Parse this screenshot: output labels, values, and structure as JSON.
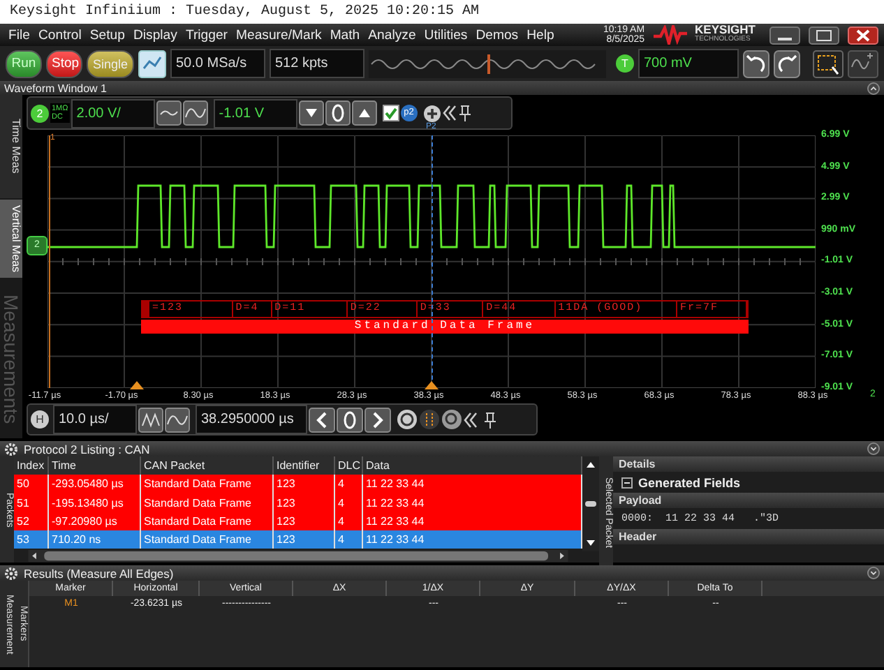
{
  "window": {
    "title": "Keysight Infiniium : Tuesday, August 5, 2025 10:20:15 AM"
  },
  "menu": [
    "File",
    "Control",
    "Setup",
    "Display",
    "Trigger",
    "Measure/Mark",
    "Math",
    "Analyze",
    "Utilities",
    "Demos",
    "Help"
  ],
  "clock": {
    "time": "10:19 AM",
    "date": "8/5/2025"
  },
  "logo": {
    "name": "KEYSIGHT",
    "sub": "TECHNOLOGIES"
  },
  "toolbar": {
    "run": "Run",
    "stop": "Stop",
    "single": "Single",
    "sample_rate": "50.0 MSa/s",
    "memory": "512 kpts",
    "trigger_badge": "T",
    "trigger_level": "700 mV"
  },
  "waveform_window": {
    "title": "Waveform Window 1",
    "channel": {
      "number": "2",
      "impedance": "1MΩ",
      "coupling": "DC",
      "scale": "2.00 V/",
      "offset": "-1.01 V",
      "visible": true,
      "probe": "p2"
    },
    "side_tabs": [
      {
        "label": "Time Meas",
        "selected": false
      },
      {
        "label": "Vertical Meas",
        "selected": true
      },
      {
        "label": "Measurements",
        "selected": false
      }
    ],
    "markers": {
      "t1": "1",
      "p2": "P2",
      "ground": "2"
    },
    "y_labels": [
      "6.99 V",
      "4.99 V",
      "2.99 V",
      "990 mV",
      "-1.01 V",
      "-3.01 V",
      "-5.01 V",
      "-7.01 V",
      "-9.01 V"
    ],
    "x_labels": [
      "-11.7 µs",
      "-1.70 µs",
      "8.30 µs",
      "18.3 µs",
      "28.3 µs",
      "38.3 µs",
      "48.3 µs",
      "58.3 µs",
      "68.3 µs",
      "78.3 µs",
      "88.3 µs"
    ],
    "x_end": "2",
    "decode": {
      "fields": [
        "=123",
        "D=4",
        "D=11",
        "D=22",
        "D=33",
        "D=44",
        "11DA (GOOD)",
        "Fr=7F"
      ],
      "frame": "Standard Data Frame"
    },
    "horizontal": {
      "badge": "H",
      "scale": "10.0 µs/",
      "position": "38.2950000 µs"
    }
  },
  "listing": {
    "title": "Protocol 2 Listing : CAN",
    "side_tab": "Packets",
    "columns": [
      "Index",
      "Time",
      "CAN Packet",
      "Identifier",
      "DLC",
      "Data"
    ],
    "rows": [
      {
        "cells": [
          "50",
          "-293.05480 µs",
          "Standard Data Frame",
          "123",
          "4",
          "11 22 33 44"
        ],
        "selected": false
      },
      {
        "cells": [
          "51",
          "-195.13480 µs",
          "Standard Data Frame",
          "123",
          "4",
          "11 22 33 44"
        ],
        "selected": false
      },
      {
        "cells": [
          "52",
          "-97.20980 µs",
          "Standard Data Frame",
          "123",
          "4",
          "11 22 33 44"
        ],
        "selected": false
      },
      {
        "cells": [
          "53",
          "710.20 ns",
          "Standard Data Frame",
          "123",
          "4",
          "11 22 33 44"
        ],
        "selected": true
      }
    ]
  },
  "packet_panel": {
    "side_tab": "Selected Packet",
    "details": "Details",
    "group": "Generated Fields",
    "payload": "Payload",
    "payload_line": "0000:  11 22 33 44   .\"3D",
    "header": "Header"
  },
  "results": {
    "title": "Results (Measure All Edges)",
    "side_tabs": [
      "Measurement",
      "Markers"
    ],
    "columns": [
      "Marker",
      "Horizontal",
      "Vertical",
      "ΔX",
      "1/ΔX",
      "ΔY",
      "ΔY/ΔX",
      "Delta To"
    ],
    "rows": [
      {
        "cells": [
          "M1",
          "-23.6231 µs",
          "---------------",
          null,
          "---",
          null,
          "---",
          "--"
        ]
      }
    ]
  }
}
